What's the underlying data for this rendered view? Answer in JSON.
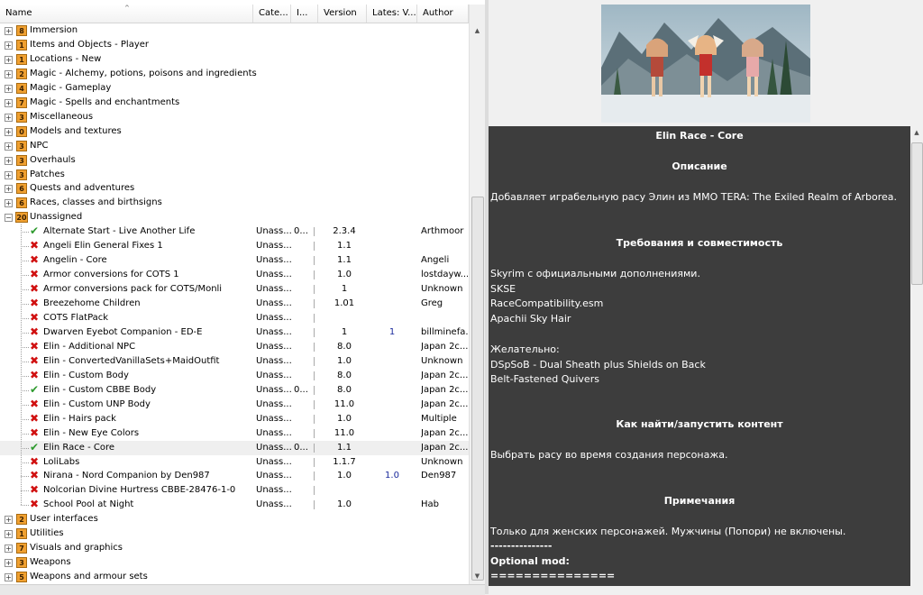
{
  "columns": {
    "name": "Name",
    "category": "Cate...",
    "installed": "I...",
    "version": "Version",
    "latest": "Lates: V...",
    "author": "Author"
  },
  "categories_top": [
    {
      "count": "8",
      "name": "Immersion"
    },
    {
      "count": "1",
      "name": "Items and Objects - Player"
    },
    {
      "count": "1",
      "name": "Locations - New"
    },
    {
      "count": "2",
      "name": "Magic - Alchemy, potions, poisons and ingredients"
    },
    {
      "count": "4",
      "name": "Magic - Gameplay"
    },
    {
      "count": "7",
      "name": "Magic - Spells and enchantments"
    },
    {
      "count": "3",
      "name": "Miscellaneous"
    },
    {
      "count": "0",
      "name": "Models and textures"
    },
    {
      "count": "3",
      "name": "NPC"
    },
    {
      "count": "3",
      "name": "Overhauls"
    },
    {
      "count": "3",
      "name": "Patches"
    },
    {
      "count": "6",
      "name": "Quests and adventures"
    },
    {
      "count": "6",
      "name": "Races, classes and birthsigns"
    }
  ],
  "unassigned": {
    "count": "20",
    "name": "Unassigned",
    "expander": "−"
  },
  "mods": [
    {
      "status": "ok",
      "name": "Alternate Start - Live Another Life",
      "category": "Unass...",
      "installed": "0...",
      "version": "2.3.4",
      "latest": "",
      "author": "Arthmoor"
    },
    {
      "status": "no",
      "name": "Angeli Elin General Fixes 1",
      "category": "Unass...",
      "installed": "",
      "version": "1.1",
      "latest": "",
      "author": ""
    },
    {
      "status": "no",
      "name": "Angelin - Core",
      "category": "Unass...",
      "installed": "",
      "version": "1.1",
      "latest": "",
      "author": "Angeli"
    },
    {
      "status": "no",
      "name": "Armor conversions for COTS 1",
      "category": "Unass...",
      "installed": "",
      "version": "1.0",
      "latest": "",
      "author": "lostdayw..."
    },
    {
      "status": "no",
      "name": "Armor conversions pack for COTS/Monli",
      "category": "Unass...",
      "installed": "",
      "version": "1",
      "latest": "",
      "author": "Unknown"
    },
    {
      "status": "no",
      "name": "Breezehome Children",
      "category": "Unass...",
      "installed": "",
      "version": "1.01",
      "latest": "",
      "author": "Greg"
    },
    {
      "status": "no",
      "name": "COTS FlatPack",
      "category": "Unass...",
      "installed": "",
      "version": "",
      "latest": "",
      "author": ""
    },
    {
      "status": "no",
      "name": "Dwarven Eyebot Companion - ED-E",
      "category": "Unass...",
      "installed": "",
      "version": "1",
      "latest": "1",
      "author": "billminefa..."
    },
    {
      "status": "no",
      "name": "Elin - Additional NPC",
      "category": "Unass...",
      "installed": "",
      "version": "8.0",
      "latest": "",
      "author": "Japan 2c..."
    },
    {
      "status": "no",
      "name": "Elin - ConvertedVanillaSets+MaidOutfit",
      "category": "Unass...",
      "installed": "",
      "version": "1.0",
      "latest": "",
      "author": "Unknown"
    },
    {
      "status": "no",
      "name": "Elin - Custom Body",
      "category": "Unass...",
      "installed": "",
      "version": "8.0",
      "latest": "",
      "author": "Japan 2c..."
    },
    {
      "status": "ok",
      "name": "Elin - Custom CBBE Body",
      "category": "Unass...",
      "installed": "0...",
      "version": "8.0",
      "latest": "",
      "author": "Japan 2c..."
    },
    {
      "status": "no",
      "name": "Elin - Custom UNP Body",
      "category": "Unass...",
      "installed": "",
      "version": "11.0",
      "latest": "",
      "author": "Japan 2c..."
    },
    {
      "status": "no",
      "name": "Elin - Hairs pack",
      "category": "Unass...",
      "installed": "",
      "version": "1.0",
      "latest": "",
      "author": "Multiple"
    },
    {
      "status": "no",
      "name": "Elin - New Eye Colors",
      "category": "Unass...",
      "installed": "",
      "version": "11.0",
      "latest": "",
      "author": "Japan 2c..."
    },
    {
      "status": "ok",
      "name": "Elin Race - Core",
      "category": "Unass...",
      "installed": "0...",
      "version": "1.1",
      "latest": "",
      "author": "Japan 2c..."
    },
    {
      "status": "no",
      "name": "LoliLabs",
      "category": "Unass...",
      "installed": "",
      "version": "1.1.7",
      "latest": "",
      "author": "Unknown"
    },
    {
      "status": "no",
      "name": "Nirana - Nord Companion by Den987",
      "category": "Unass...",
      "installed": "",
      "version": "1.0",
      "latest": "1.0",
      "author": "Den987"
    },
    {
      "status": "no",
      "name": "Nolcorian Divine Hurtress CBBE-28476-1-0",
      "category": "Unass...",
      "installed": "",
      "version": "",
      "latest": "",
      "author": ""
    },
    {
      "status": "no",
      "name": "School Pool at Night",
      "category": "Unass...",
      "installed": "",
      "version": "1.0",
      "latest": "",
      "author": "Hab"
    }
  ],
  "categories_bottom": [
    {
      "count": "2",
      "name": "User interfaces"
    },
    {
      "count": "1",
      "name": "Utilities"
    },
    {
      "count": "7",
      "name": "Visuals and graphics"
    },
    {
      "count": "3",
      "name": "Weapons"
    },
    {
      "count": "5",
      "name": "Weapons and armour sets"
    }
  ],
  "icons": {
    "expand": "+",
    "ok": "✔",
    "no": "✖",
    "scroll_up": "▲",
    "scroll_down": "▼",
    "sort": "^"
  },
  "description": {
    "title": "Elin Race - Core",
    "heading_description": "Описание",
    "text_description": "Добавляет играбельную расу Элин из MMO TERA: The Exiled Realm of Arborea.",
    "heading_requirements": "Требования и совместимость",
    "requirements": [
      "Skyrim с официальными дополнениями.",
      "SKSE",
      "RaceCompatibility.esm",
      "Apachii Sky Hair"
    ],
    "recommended_label": "Желательно:",
    "recommended": [
      "DSpSoB - Dual Sheath plus Shields on Back",
      "Belt-Fastened Quivers"
    ],
    "heading_howto": "Как найти/запустить контент",
    "text_howto": "Выбрать расу во время создания персонажа.",
    "heading_notes": "Примечания",
    "text_notes": "Только для женских персонажей. Мужчины (Попори) не включены.",
    "separator1": "---------------",
    "optional_label": "Optional mod:",
    "separator2": "==============="
  }
}
